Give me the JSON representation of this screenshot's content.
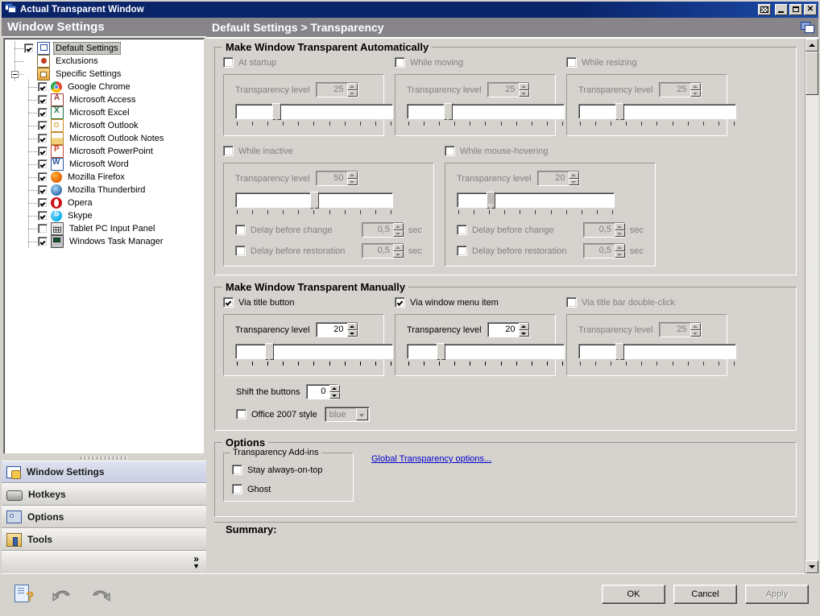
{
  "window": {
    "title": "Actual Transparent Window",
    "icon": "window-icon",
    "buttons": {
      "transparency": "transparency-button",
      "minimize": "_",
      "maximize": "maximize-button",
      "close": "✕"
    }
  },
  "sidebar": {
    "header": "Window Settings",
    "tree": [
      {
        "label": "Default Settings",
        "checked": true,
        "selected": true,
        "level": 1,
        "icon": "ico-winset",
        "hasCheckbox": true
      },
      {
        "label": "Exclusions",
        "checked": false,
        "selected": false,
        "level": 1,
        "icon": "ico-excl",
        "hasCheckbox": false
      },
      {
        "label": "Specific Settings",
        "checked": false,
        "selected": false,
        "level": 1,
        "icon": "ico-spec",
        "hasCheckbox": false,
        "expander": true
      },
      {
        "label": "Google Chrome",
        "checked": true,
        "selected": false,
        "level": 2,
        "icon": "ico-chrome",
        "hasCheckbox": true
      },
      {
        "label": "Microsoft Access",
        "checked": true,
        "selected": false,
        "level": 2,
        "icon": "ico-access",
        "hasCheckbox": true
      },
      {
        "label": "Microsoft Excel",
        "checked": true,
        "selected": false,
        "level": 2,
        "icon": "ico-excel",
        "hasCheckbox": true
      },
      {
        "label": "Microsoft Outlook",
        "checked": true,
        "selected": false,
        "level": 2,
        "icon": "ico-outlook",
        "hasCheckbox": true
      },
      {
        "label": "Microsoft Outlook Notes",
        "checked": true,
        "selected": false,
        "level": 2,
        "icon": "ico-onotes",
        "hasCheckbox": true
      },
      {
        "label": "Microsoft PowerPoint",
        "checked": true,
        "selected": false,
        "level": 2,
        "icon": "ico-ppt",
        "hasCheckbox": true
      },
      {
        "label": "Microsoft Word",
        "checked": true,
        "selected": false,
        "level": 2,
        "icon": "ico-word",
        "hasCheckbox": true
      },
      {
        "label": "Mozilla Firefox",
        "checked": true,
        "selected": false,
        "level": 2,
        "icon": "ico-firefox",
        "hasCheckbox": true
      },
      {
        "label": "Mozilla Thunderbird",
        "checked": true,
        "selected": false,
        "level": 2,
        "icon": "ico-thunder",
        "hasCheckbox": true
      },
      {
        "label": "Opera",
        "checked": true,
        "selected": false,
        "level": 2,
        "icon": "ico-opera",
        "hasCheckbox": true
      },
      {
        "label": "Skype",
        "checked": true,
        "selected": false,
        "level": 2,
        "icon": "ico-skype",
        "hasCheckbox": true
      },
      {
        "label": "Tablet PC Input Panel",
        "checked": false,
        "selected": false,
        "level": 2,
        "icon": "ico-tablet",
        "hasCheckbox": true
      },
      {
        "label": "Windows Task Manager",
        "checked": true,
        "selected": false,
        "level": 2,
        "icon": "ico-taskmgr",
        "hasCheckbox": true
      }
    ],
    "nav": [
      {
        "label": "Window Settings",
        "active": true,
        "icon": "window-settings-icon"
      },
      {
        "label": "Hotkeys",
        "active": false,
        "icon": "hotkeys-icon"
      },
      {
        "label": "Options",
        "active": false,
        "icon": "options-icon"
      },
      {
        "label": "Tools",
        "active": false,
        "icon": "tools-icon"
      }
    ],
    "more": "»"
  },
  "content": {
    "header": "Default Settings > Transparency",
    "auto": {
      "title": "Make Window Transparent Automatically",
      "row1": [
        {
          "label": "At startup",
          "checked": false,
          "enabled": false,
          "levelLabel": "Transparency level",
          "level": "25",
          "thumbPercent": 25
        },
        {
          "label": "While moving",
          "checked": false,
          "enabled": false,
          "levelLabel": "Transparency level",
          "level": "25",
          "thumbPercent": 25
        },
        {
          "label": "While resizing",
          "checked": false,
          "enabled": false,
          "levelLabel": "Transparency level",
          "level": "25",
          "thumbPercent": 25
        }
      ],
      "row2": [
        {
          "label": "While inactive",
          "checked": false,
          "enabled": false,
          "levelLabel": "Transparency level",
          "level": "50",
          "thumbPercent": 50,
          "delayChange": {
            "label": "Delay before change",
            "checked": false,
            "value": "0,5",
            "unit": "sec"
          },
          "delayRestore": {
            "label": "Delay before restoration",
            "checked": false,
            "value": "0,5",
            "unit": "sec"
          }
        },
        {
          "label": "While mouse-hovering",
          "checked": false,
          "enabled": false,
          "levelLabel": "Transparency level",
          "level": "20",
          "thumbPercent": 20,
          "delayChange": {
            "label": "Delay before change",
            "checked": false,
            "value": "0,5",
            "unit": "sec"
          },
          "delayRestore": {
            "label": "Delay before restoration",
            "checked": false,
            "value": "0,5",
            "unit": "sec"
          }
        }
      ]
    },
    "manual": {
      "title": "Make Window Transparent Manually",
      "items": [
        {
          "label": "Via title button",
          "checked": true,
          "enabled": true,
          "levelLabel": "Transparency level",
          "level": "20",
          "thumbPercent": 20
        },
        {
          "label": "Via window menu item",
          "checked": true,
          "enabled": true,
          "levelLabel": "Transparency level",
          "level": "20",
          "thumbPercent": 20
        },
        {
          "label": "Via title bar double-click",
          "checked": false,
          "enabled": false,
          "levelLabel": "Transparency level",
          "level": "25",
          "thumbPercent": 25
        }
      ],
      "shift": {
        "label": "Shift the buttons",
        "value": "0"
      },
      "office": {
        "label": "Office 2007 style",
        "checked": false,
        "value": "blue"
      }
    },
    "options": {
      "title": "Options",
      "addins": {
        "title": "Transparency Add-ins",
        "items": [
          {
            "label": "Stay always-on-top",
            "checked": false
          },
          {
            "label": "Ghost",
            "checked": false
          }
        ]
      },
      "link": "Global Transparency options..."
    },
    "summary": {
      "title": "Summary:"
    }
  },
  "footer": {
    "help": "help-icon",
    "undo": "undo-icon",
    "redo": "redo-icon",
    "ok": "OK",
    "cancel": "Cancel",
    "apply": "Apply"
  },
  "colors": {
    "titlebar": "#0a246a",
    "header_bar": "#87858a",
    "face": "#d6d3ce",
    "link": "#0000c8",
    "disabled_text": "#808080",
    "selection": "#c8c6c1"
  }
}
